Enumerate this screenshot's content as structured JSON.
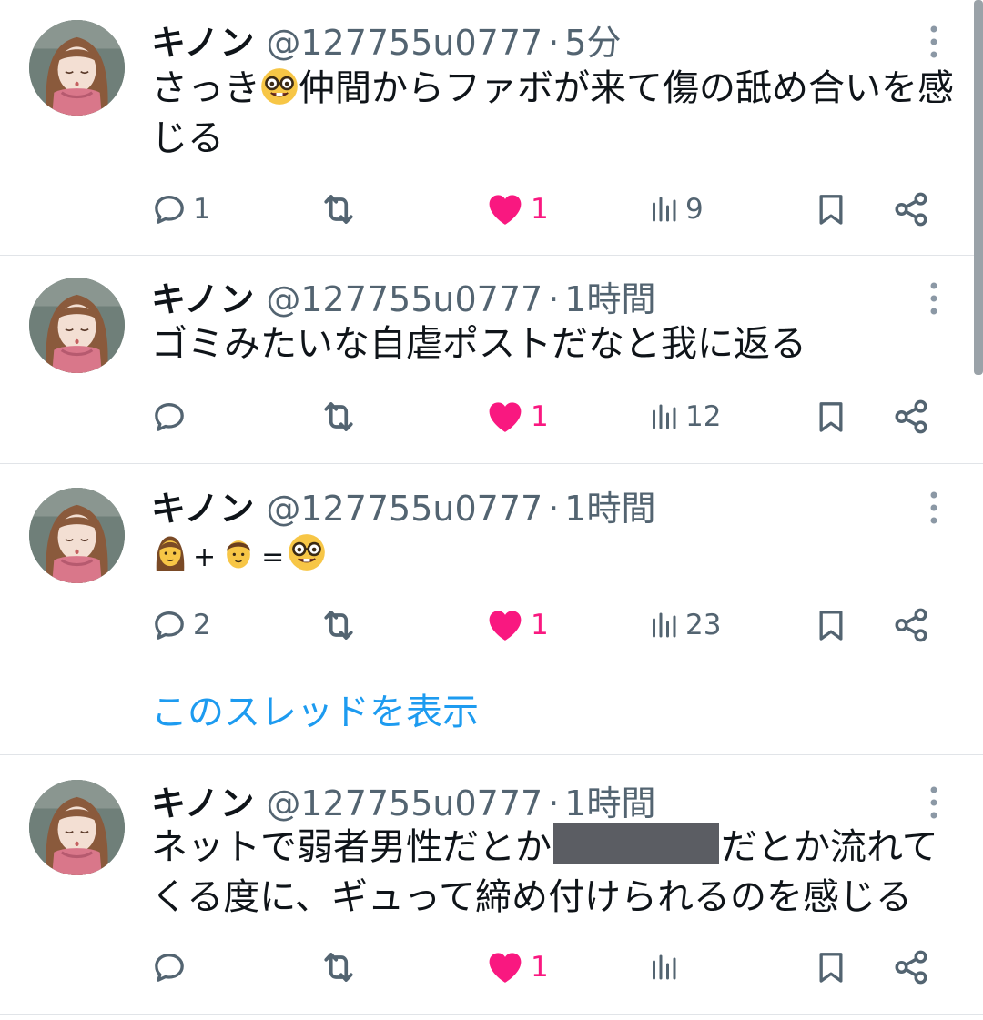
{
  "tweets": [
    {
      "name": "キノン",
      "handle": "@127755u0777",
      "separator": "·",
      "time": "5分",
      "text_before": "さっき",
      "text_after": "仲間からファボが来て傷の舐め合いを感じる",
      "reply_count": "1",
      "like_count": "1",
      "view_count": "9"
    },
    {
      "name": "キノン",
      "handle": "@127755u0777",
      "separator": "·",
      "time": "1時間",
      "text": "ゴミみたいな自虐ポストだなと我に返る",
      "reply_count": "",
      "like_count": "1",
      "view_count": "12"
    },
    {
      "name": "キノン",
      "handle": "@127755u0777",
      "separator": "·",
      "time": "1時間",
      "plus": "+",
      "equals": "=",
      "reply_count": "2",
      "like_count": "1",
      "view_count": "23",
      "thread_link": "このスレッドを表示"
    },
    {
      "name": "キノン",
      "handle": "@127755u0777",
      "separator": "·",
      "time": "1時間",
      "text_before": "ネットで弱者男性だとか",
      "text_after": "だとか流れてくる度に、ギュって締め付けられるのを感じる",
      "reply_count": "",
      "like_count": "1",
      "view_count": ""
    }
  ],
  "icons": {
    "reply": "reply-icon",
    "retweet": "retweet-icon",
    "like": "heart-icon",
    "views": "views-icon",
    "bookmark": "bookmark-icon",
    "share": "share-icon",
    "more": "more-icon"
  },
  "colors": {
    "like": "#f91880",
    "link": "#1d9bf0",
    "secondary_text": "#536471"
  }
}
